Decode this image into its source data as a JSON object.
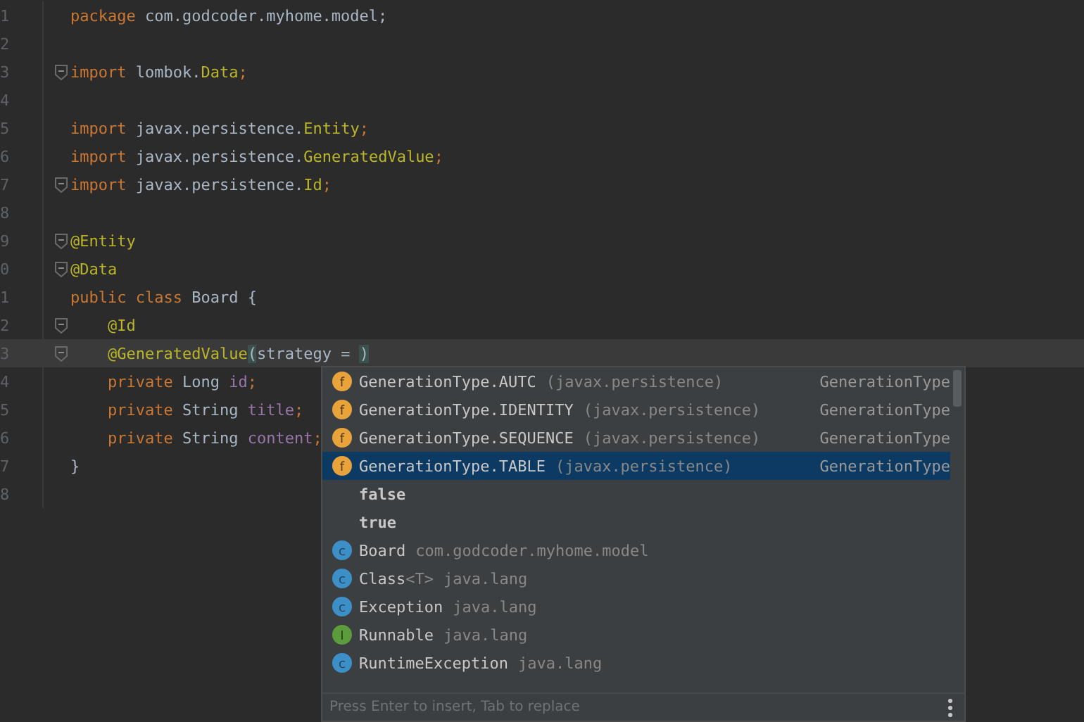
{
  "editor": {
    "lines": [
      {
        "number": "1",
        "fold": false,
        "current": false,
        "tokens": [
          {
            "kind": "keyword",
            "text": "package"
          },
          {
            "kind": "plain",
            "text": " com.godcoder.myhome.model;"
          }
        ]
      },
      {
        "number": "2",
        "fold": false,
        "current": false
      },
      {
        "number": "3",
        "fold": true,
        "current": false,
        "tokens": [
          {
            "kind": "keyword",
            "text": "import"
          },
          {
            "kind": "plain",
            "text": " lombok."
          },
          {
            "kind": "annotation",
            "text": "Data"
          },
          {
            "kind": "keyword",
            "text": ";"
          }
        ]
      },
      {
        "number": "4",
        "fold": false,
        "current": false
      },
      {
        "number": "5",
        "fold": false,
        "current": false,
        "tokens": [
          {
            "kind": "keyword",
            "text": "import"
          },
          {
            "kind": "plain",
            "text": " javax.persistence."
          },
          {
            "kind": "annotation",
            "text": "Entity"
          },
          {
            "kind": "keyword",
            "text": ";"
          }
        ]
      },
      {
        "number": "6",
        "fold": false,
        "current": false,
        "tokens": [
          {
            "kind": "keyword",
            "text": "import"
          },
          {
            "kind": "plain",
            "text": " javax.persistence."
          },
          {
            "kind": "annotation",
            "text": "GeneratedValue"
          },
          {
            "kind": "keyword",
            "text": ";"
          }
        ]
      },
      {
        "number": "7",
        "fold": true,
        "current": false,
        "tokens": [
          {
            "kind": "keyword",
            "text": "import"
          },
          {
            "kind": "plain",
            "text": " javax.persistence."
          },
          {
            "kind": "annotation",
            "text": "Id"
          },
          {
            "kind": "keyword",
            "text": ";"
          }
        ]
      },
      {
        "number": "8",
        "fold": false,
        "current": false
      },
      {
        "number": "9",
        "fold": true,
        "current": false,
        "tokens": [
          {
            "kind": "annotation",
            "text": "@Entity"
          }
        ]
      },
      {
        "number": "0",
        "fold": true,
        "current": false,
        "tokens": [
          {
            "kind": "annotation",
            "text": "@Data"
          }
        ]
      },
      {
        "number": "1",
        "fold": false,
        "current": false,
        "tokens": [
          {
            "kind": "keyword",
            "text": "public class"
          },
          {
            "kind": "plain",
            "text": " Board {"
          }
        ]
      },
      {
        "number": "2",
        "fold": true,
        "current": false,
        "tokens": [
          {
            "kind": "annotation",
            "text": "    @Id"
          }
        ]
      },
      {
        "number": "3",
        "fold": true,
        "current": true,
        "tokens": [
          {
            "kind": "annotation",
            "text": "    @GeneratedValue"
          },
          {
            "kind": "match",
            "text": "("
          },
          {
            "kind": "plain",
            "text": "strategy = "
          },
          {
            "kind": "match",
            "text": ")"
          }
        ]
      },
      {
        "number": "4",
        "fold": false,
        "current": false,
        "tokens": [
          {
            "kind": "keyword",
            "text": "    private"
          },
          {
            "kind": "plain",
            "text": " Long "
          },
          {
            "kind": "field",
            "text": "id"
          },
          {
            "kind": "keyword",
            "text": ";"
          }
        ]
      },
      {
        "number": "5",
        "fold": false,
        "current": false,
        "tokens": [
          {
            "kind": "keyword",
            "text": "    private"
          },
          {
            "kind": "plain",
            "text": " String "
          },
          {
            "kind": "field",
            "text": "title"
          },
          {
            "kind": "keyword",
            "text": ";"
          }
        ]
      },
      {
        "number": "6",
        "fold": false,
        "current": false,
        "tokens": [
          {
            "kind": "keyword",
            "text": "    private"
          },
          {
            "kind": "plain",
            "text": " String "
          },
          {
            "kind": "field",
            "text": "content"
          },
          {
            "kind": "keyword",
            "text": ";"
          }
        ]
      },
      {
        "number": "7",
        "fold": false,
        "current": false,
        "tokens": [
          {
            "kind": "plain",
            "text": "}"
          }
        ]
      },
      {
        "number": "8",
        "fold": false,
        "current": false
      }
    ]
  },
  "completion": {
    "items": [
      {
        "kind": "field",
        "icon_letter": "f",
        "label": "GenerationType.AUTC",
        "detail": "(javax.persistence)",
        "type": "GenerationType",
        "selected": false
      },
      {
        "kind": "field",
        "icon_letter": "f",
        "label": "GenerationType.IDENTITY",
        "detail": "(javax.persistence)",
        "type": "GenerationType",
        "selected": false
      },
      {
        "kind": "field",
        "icon_letter": "f",
        "label": "GenerationType.SEQUENCE",
        "detail": "(javax.persistence)",
        "type": "GenerationType",
        "selected": false
      },
      {
        "kind": "field",
        "icon_letter": "f",
        "label": "GenerationType.TABLE",
        "detail": "(javax.persistence)",
        "type": "GenerationType",
        "selected": true
      },
      {
        "kind": "keyword",
        "label": "false",
        "selected": false
      },
      {
        "kind": "keyword",
        "label": "true",
        "selected": false
      },
      {
        "kind": "class",
        "icon_letter": "c",
        "label": "Board",
        "detail": "com.godcoder.myhome.model",
        "selected": false
      },
      {
        "kind": "class",
        "icon_letter": "c",
        "label": "Class",
        "params": "<T>",
        "detail": "java.lang",
        "selected": false
      },
      {
        "kind": "class",
        "icon_letter": "c",
        "label": "Exception",
        "detail": "java.lang",
        "selected": false
      },
      {
        "kind": "interface",
        "icon_letter": "I",
        "label": "Runnable",
        "detail": "java.lang",
        "selected": false
      },
      {
        "kind": "class",
        "icon_letter": "c",
        "label": "RuntimeException",
        "detail": "java.lang",
        "selected": false
      }
    ],
    "hint": "Press Enter to insert, Tab to replace"
  }
}
